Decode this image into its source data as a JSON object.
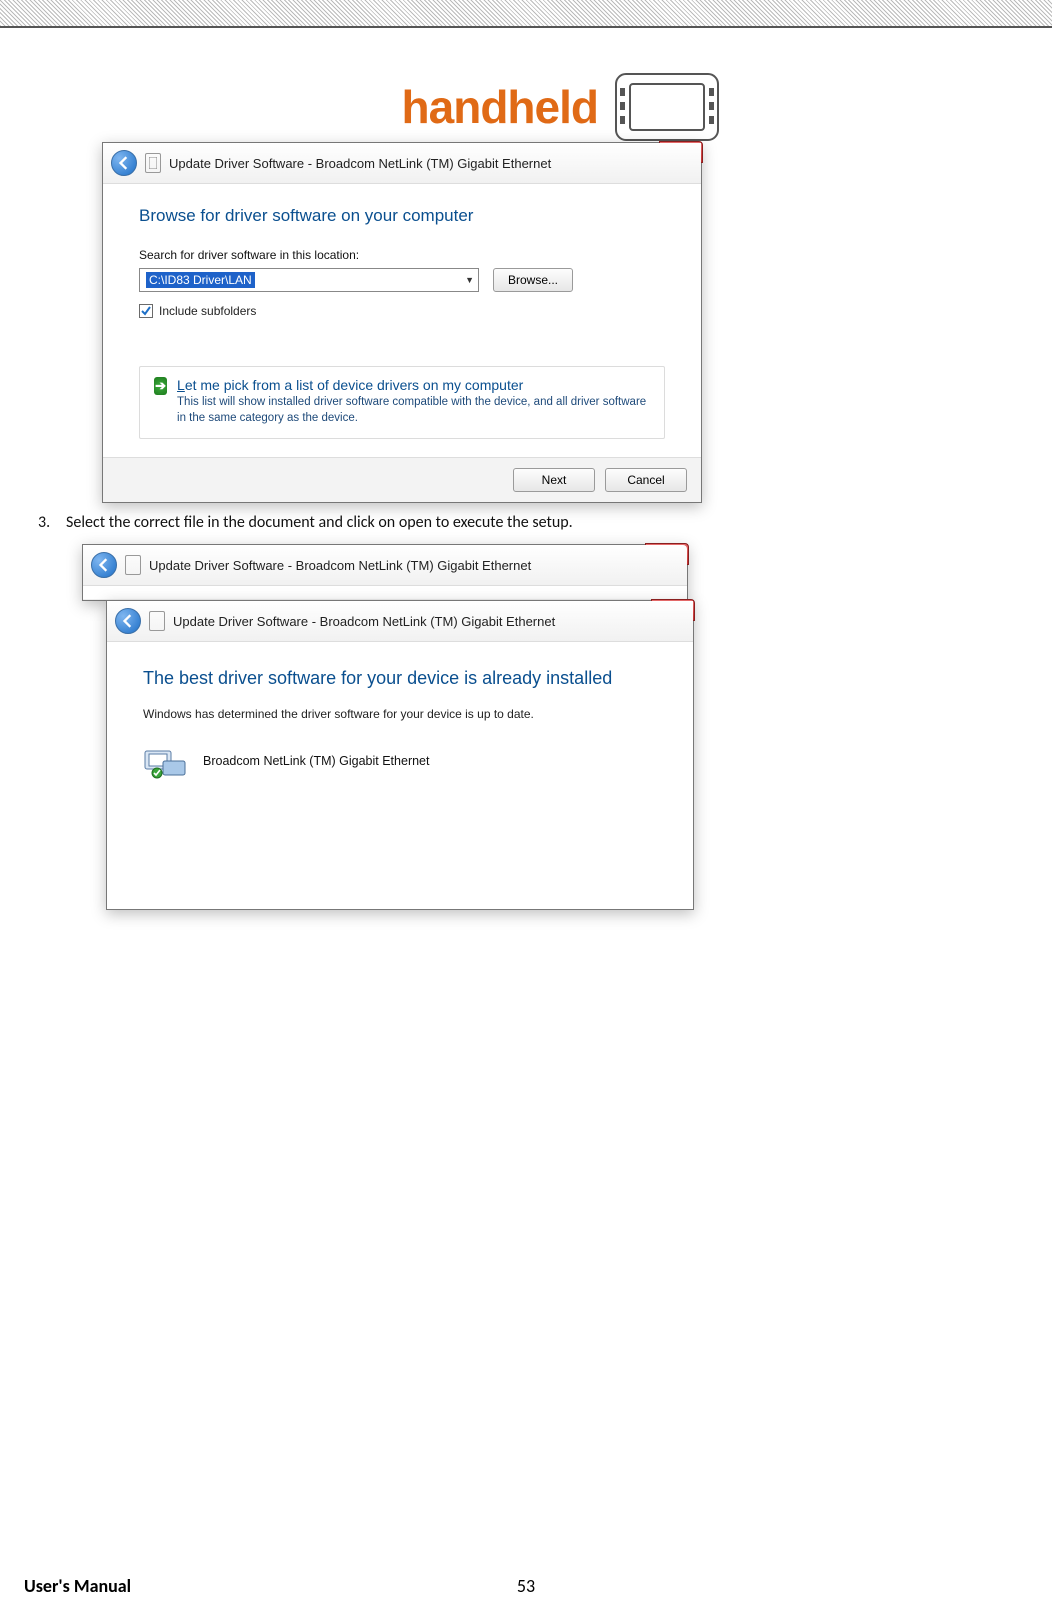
{
  "brand": {
    "name": "handheld"
  },
  "screenshot1": {
    "title": "Update Driver Software - Broadcom NetLink (TM) Gigabit Ethernet",
    "heading": "Browse for driver software on your computer",
    "search_label": "Search for driver software in this location:",
    "path_value": "C:\\ID83 Driver\\LAN",
    "browse_label": "Browse...",
    "include_subfolders_label": "Include subfolders",
    "option_title_prefix": "L",
    "option_title_rest": "et me pick from a list of device drivers on my computer",
    "option_desc": "This list will show installed driver software compatible with the device, and all driver software in the same category as the device.",
    "next_label": "Next",
    "cancel_label": "Cancel"
  },
  "instruction": {
    "number": "3.",
    "text": "Select the correct file in the document and click on open to execute the setup."
  },
  "screenshot2": {
    "back_title": "Update Driver Software - Broadcom NetLink (TM) Gigabit Ethernet",
    "front_title": "Update Driver Software - Broadcom NetLink (TM) Gigabit Ethernet",
    "heading": "The best driver software for your device is already installed",
    "body_text": "Windows has determined the driver software for your device is up to date.",
    "driver_name": "Broadcom NetLink (TM) Gigabit Ethernet"
  },
  "footer": {
    "left": "User's Manual",
    "page": "53"
  }
}
